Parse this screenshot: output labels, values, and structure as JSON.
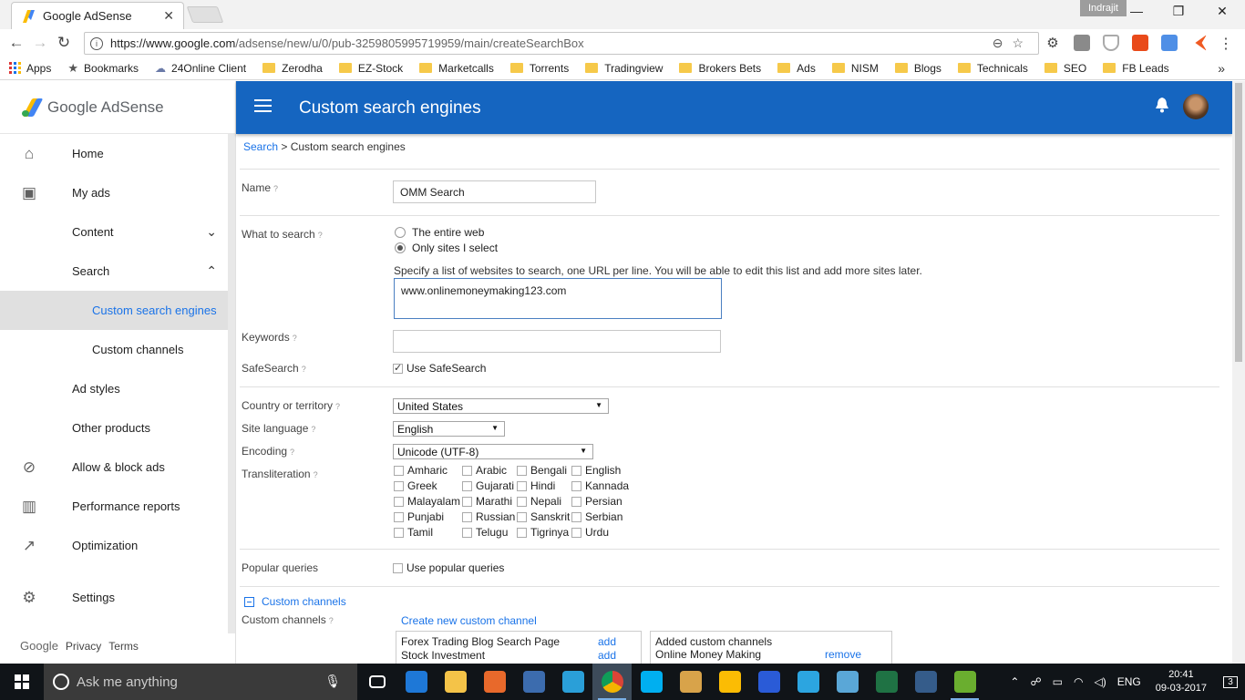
{
  "browser": {
    "tab_title": "Google AdSense",
    "tab_close": "✕",
    "profile_name": "Indrajit",
    "url_host": "https://www.google.com",
    "url_path": "/adsense/new/u/0/pub-3259805995719959/main/createSearchBox",
    "win_minimize": "—",
    "win_restore": "❐",
    "win_close": "✕",
    "nav_back": "←",
    "nav_forward": "→",
    "nav_reload": "↻",
    "more_menu": "⋮",
    "bookmarks": [
      {
        "label": "Apps",
        "type": "apps"
      },
      {
        "label": "Bookmarks",
        "type": "star"
      },
      {
        "label": "24Online Client",
        "type": "page"
      },
      {
        "label": "Zerodha",
        "type": "folder"
      },
      {
        "label": "EZ-Stock",
        "type": "folder"
      },
      {
        "label": "Marketcalls",
        "type": "folder"
      },
      {
        "label": "Torrents",
        "type": "folder"
      },
      {
        "label": "Tradingview",
        "type": "folder"
      },
      {
        "label": "Brokers Bets",
        "type": "folder"
      },
      {
        "label": "Ads",
        "type": "folder"
      },
      {
        "label": "NISM",
        "type": "folder"
      },
      {
        "label": "Blogs",
        "type": "folder"
      },
      {
        "label": "Technicals",
        "type": "folder"
      },
      {
        "label": "SEO",
        "type": "folder"
      },
      {
        "label": "FB Leads",
        "type": "folder"
      }
    ],
    "bookmarks_more": "»"
  },
  "sidebar": {
    "brand": "Google AdSense",
    "items": [
      {
        "label": "Home",
        "icon": "home-icon",
        "glyph": "⌂"
      },
      {
        "label": "My ads",
        "icon": "my-ads-icon",
        "glyph": "▣"
      },
      {
        "label": "Content",
        "icon": "",
        "glyph": "",
        "chevron": "⌄"
      },
      {
        "label": "Search",
        "icon": "",
        "glyph": "",
        "chevron": "⌃"
      },
      {
        "label": "Custom search engines",
        "sub": true,
        "active": true
      },
      {
        "label": "Custom channels",
        "sub": true
      },
      {
        "label": "Ad styles",
        "icon": "",
        "glyph": ""
      },
      {
        "label": "Other products",
        "icon": "",
        "glyph": ""
      },
      {
        "label": "Allow & block ads",
        "icon": "block-icon",
        "glyph": "⊘"
      },
      {
        "label": "Performance reports",
        "icon": "bar-chart-icon",
        "glyph": "▥"
      },
      {
        "label": "Optimization",
        "icon": "trending-up-icon",
        "glyph": "↗"
      },
      {
        "label": "Settings",
        "icon": "gear-icon",
        "glyph": "⚙"
      }
    ],
    "footer": {
      "google": "Google",
      "privacy": "Privacy",
      "terms": "Terms"
    }
  },
  "header": {
    "title": "Custom search engines",
    "bell": "🔔"
  },
  "breadcrumb": {
    "root": "Search",
    "sep": " > ",
    "current": "Custom search engines"
  },
  "form": {
    "help": "?",
    "name_label": "Name",
    "name_value": "OMM Search",
    "what_label": "What to search",
    "what_options": [
      {
        "label": "The entire web",
        "selected": false
      },
      {
        "label": "Only sites I select",
        "selected": true
      }
    ],
    "sites_note": "Specify a list of websites to search, one URL per line. You will be able to edit this list and add more sites later.",
    "sites_value": "www.onlinemoneymaking123.com",
    "keywords_label": "Keywords",
    "keywords_value": "",
    "safesearch_label": "SafeSearch",
    "safesearch_check": "Use SafeSearch",
    "safesearch_on": true,
    "country_label": "Country or territory",
    "country_value": "United States",
    "language_label": "Site language",
    "language_value": "English",
    "encoding_label": "Encoding",
    "encoding_value": "Unicode (UTF-8)",
    "translit_label": "Transliteration",
    "translit": [
      "Amharic",
      "Arabic",
      "Bengali",
      "English",
      "Greek",
      "Gujarati",
      "Hindi",
      "Kannada",
      "Malayalam",
      "Marathi",
      "Nepali",
      "Persian",
      "Punjabi",
      "Russian",
      "Sanskrit",
      "Serbian",
      "Tamil",
      "Telugu",
      "Tigrinya",
      "Urdu"
    ],
    "popular_label": "Popular queries",
    "popular_check": "Use popular queries",
    "channels_toggle": "Custom channels",
    "channels_label": "Custom channels",
    "create_channel": "Create new custom channel",
    "available_channels": [
      {
        "name": "Forex Trading Blog Search Page",
        "action": "add"
      },
      {
        "name": "Stock Investment",
        "action": "add"
      }
    ],
    "added_header": "Added custom channels",
    "added_channels": [
      {
        "name": "Online Money Making",
        "action": "remove"
      }
    ]
  },
  "taskbar": {
    "search_placeholder": "Ask me anything",
    "time": "20:41",
    "date": "09-03-2017",
    "lang": "ENG",
    "notif_count": "3",
    "apps": [
      {
        "name": "task-view",
        "color": "#101418"
      },
      {
        "name": "edge",
        "color": "#1e78d7"
      },
      {
        "name": "file-explorer",
        "color": "#f4c348"
      },
      {
        "name": "firefox",
        "color": "#e8692b"
      },
      {
        "name": "thunderbird",
        "color": "#3c6cae"
      },
      {
        "name": "internet-explorer",
        "color": "#2a9fd8"
      },
      {
        "name": "chrome",
        "color": "#e3412f",
        "active": true
      },
      {
        "name": "skype",
        "color": "#00aff0"
      },
      {
        "name": "paint",
        "color": "#d8a34a"
      },
      {
        "name": "gdrive",
        "color": "#fbbc04"
      },
      {
        "name": "app-moon",
        "color": "#2a5bd7"
      },
      {
        "name": "telegram",
        "color": "#2ca5e0"
      },
      {
        "name": "notes",
        "color": "#5aa7d7"
      },
      {
        "name": "excel",
        "color": "#1f7244"
      },
      {
        "name": "app-q",
        "color": "#355c8a"
      },
      {
        "name": "bluestacks",
        "color": "#6aae2f",
        "running": true
      }
    ]
  }
}
